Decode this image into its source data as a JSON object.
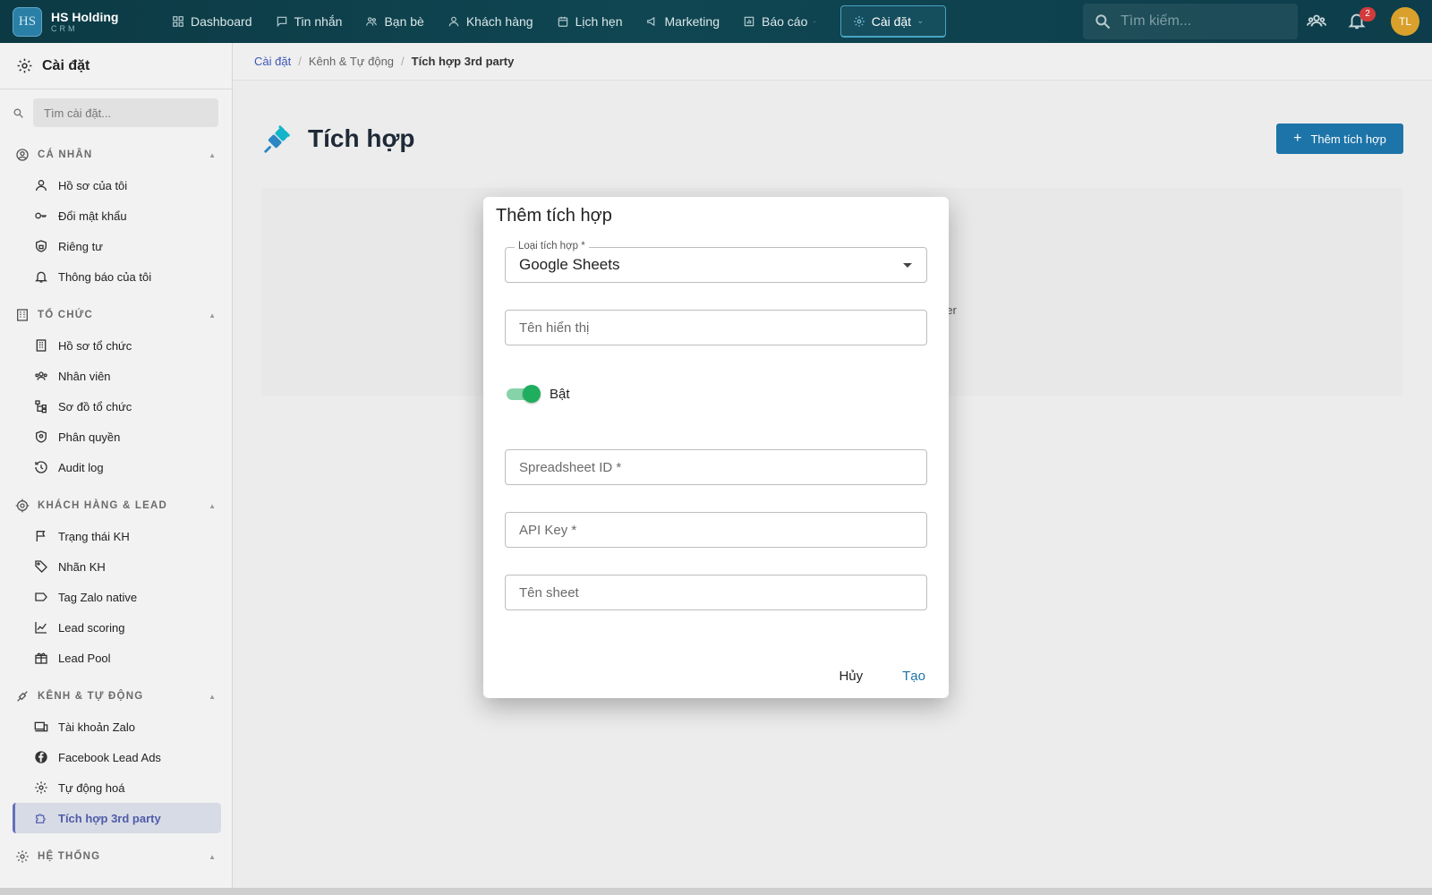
{
  "app": {
    "logo_mark": "HS",
    "name": "HS Holding",
    "subtitle": "CRM"
  },
  "topnav": {
    "items": [
      {
        "label": "Dashboard",
        "icon": "grid-icon"
      },
      {
        "label": "Tin nhắn",
        "icon": "chat-icon"
      },
      {
        "label": "Bạn bè",
        "icon": "friends-icon"
      },
      {
        "label": "Khách hàng",
        "icon": "person-icon"
      },
      {
        "label": "Lịch hẹn",
        "icon": "calendar-icon"
      },
      {
        "label": "Marketing",
        "icon": "megaphone-icon"
      },
      {
        "label": "Báo cáo",
        "icon": "chart-icon"
      },
      {
        "label": "Cài đặt",
        "icon": "gear-icon",
        "active": true
      }
    ],
    "search_placeholder": "Tìm kiếm...",
    "notification_count": "2",
    "avatar_initials": "TL"
  },
  "sidebar": {
    "title": "Cài đặt",
    "search_placeholder": "Tìm cài đặt...",
    "sections": [
      {
        "label": "CÁ NHÂN",
        "items": [
          "Hồ sơ của tôi",
          "Đổi mật khẩu",
          "Riêng tư",
          "Thông báo của tôi"
        ]
      },
      {
        "label": "TỔ CHỨC",
        "items": [
          "Hồ sơ tổ chức",
          "Nhân viên",
          "Sơ đồ tổ chức",
          "Phân quyền",
          "Audit log"
        ]
      },
      {
        "label": "KHÁCH HÀNG & LEAD",
        "items": [
          "Trạng thái KH",
          "Nhãn KH",
          "Tag Zalo native",
          "Lead scoring",
          "Lead Pool"
        ]
      },
      {
        "label": "KÊNH & TỰ ĐỘNG",
        "items": [
          "Tài khoản Zalo",
          "Facebook Lead Ads",
          "Tự động hoá",
          "Tích hợp 3rd party"
        ]
      },
      {
        "label": "HỆ THỐNG",
        "items": []
      }
    ],
    "selected_item": "Tích hợp 3rd party"
  },
  "breadcrumb": {
    "level1": "Cài đặt",
    "level2": "Kênh & Tự động",
    "current": "Tích hợp 3rd party"
  },
  "page": {
    "title": "Tích hợp",
    "add_button": "Thêm tích hợp",
    "card_partial_text": "Zapier"
  },
  "dialog": {
    "title": "Thêm tích hợp",
    "type_label": "Loại tích hợp *",
    "type_value": "Google Sheets",
    "display_name_placeholder": "Tên hiển thị",
    "toggle_label": "Bật",
    "toggle_on": true,
    "spreadsheet_id_placeholder": "Spreadsheet ID *",
    "api_key_placeholder": "API Key *",
    "sheet_name_placeholder": "Tên sheet",
    "cancel_label": "Hủy",
    "create_label": "Tạo"
  },
  "colors": {
    "topbar": "#0f4652",
    "accent": "#1d74a8",
    "toggle": "#1fae5e",
    "selected_nav": "#4f5ba8"
  }
}
